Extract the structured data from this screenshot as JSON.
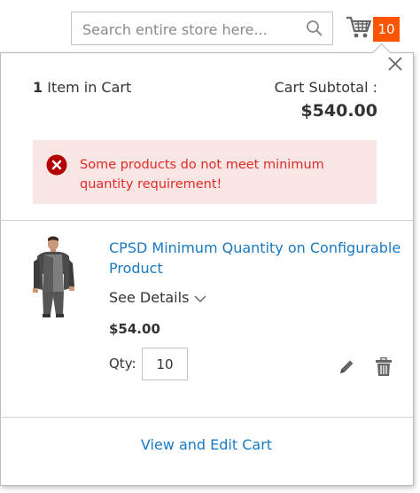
{
  "search": {
    "placeholder": "Search entire store here..."
  },
  "header": {
    "cart_count": "10"
  },
  "minicart": {
    "items_count": "1",
    "items_label": "Item in Cart",
    "subtotal_label": "Cart Subtotal :",
    "subtotal_amount": "$540.00",
    "error_message": "Some products do not meet minimum quantity requirement!",
    "product": {
      "name": "CPSD Minimum Quantity on Configurable Product",
      "details_label": "See Details",
      "price": "$54.00",
      "qty_label": "Qty:",
      "qty_value": "10"
    },
    "view_cart_label": "View and Edit Cart"
  },
  "colors": {
    "link": "#1979c3",
    "badge": "#ff5501",
    "error_bg": "#fae5e5",
    "error_text": "#e02b27"
  },
  "icons": [
    "search-icon",
    "cart-icon",
    "close-icon",
    "error-icon",
    "chevron-down-icon",
    "edit-icon",
    "trash-icon"
  ]
}
